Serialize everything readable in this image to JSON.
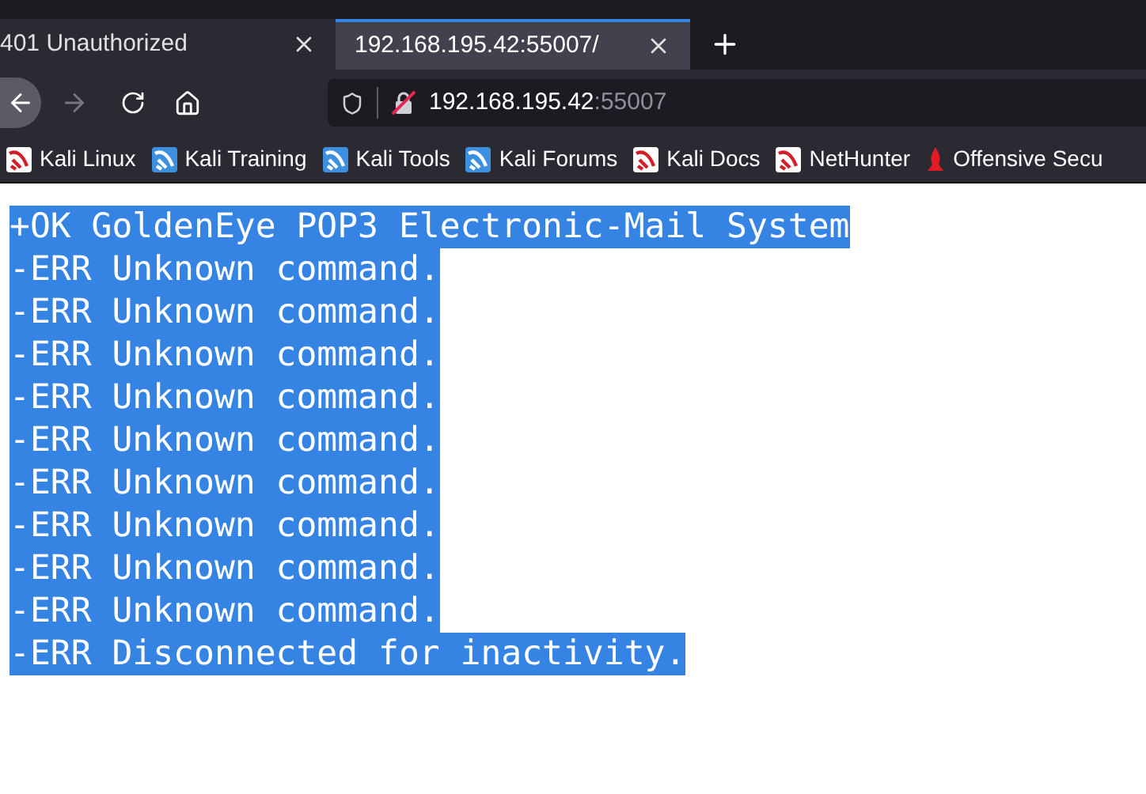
{
  "tabs": [
    {
      "label": "401 Unauthorized",
      "selected": false
    },
    {
      "label": "192.168.195.42:55007/",
      "selected": true
    }
  ],
  "address_bar": {
    "host": "192.168.195.42",
    "port": ":55007"
  },
  "bookmarks": [
    {
      "label": "Kali Linux",
      "kind": "red"
    },
    {
      "label": "Kali Training",
      "kind": "blue"
    },
    {
      "label": "Kali Tools",
      "kind": "blue"
    },
    {
      "label": "Kali Forums",
      "kind": "blue"
    },
    {
      "label": "Kali Docs",
      "kind": "red"
    },
    {
      "label": "NetHunter",
      "kind": "red"
    },
    {
      "label": "Offensive Secu",
      "kind": "flame"
    }
  ],
  "page_lines": [
    {
      "text": "+OK GoldenEye POP3 Electronic-Mail System",
      "selected": true
    },
    {
      "text": "-ERR Unknown command.",
      "selected": true
    },
    {
      "text": "-ERR Unknown command.",
      "selected": true
    },
    {
      "text": "-ERR Unknown command.",
      "selected": true
    },
    {
      "text": "-ERR Unknown command.",
      "selected": true
    },
    {
      "text": "-ERR Unknown command.",
      "selected": true
    },
    {
      "text": "-ERR Unknown command.",
      "selected": true
    },
    {
      "text": "-ERR Unknown command.",
      "selected": true
    },
    {
      "text": "-ERR Unknown command.",
      "selected": true
    },
    {
      "text": "-ERR Unknown command.",
      "selected": true
    },
    {
      "text": "-ERR Disconnected for inactivity.",
      "selected": true
    }
  ]
}
